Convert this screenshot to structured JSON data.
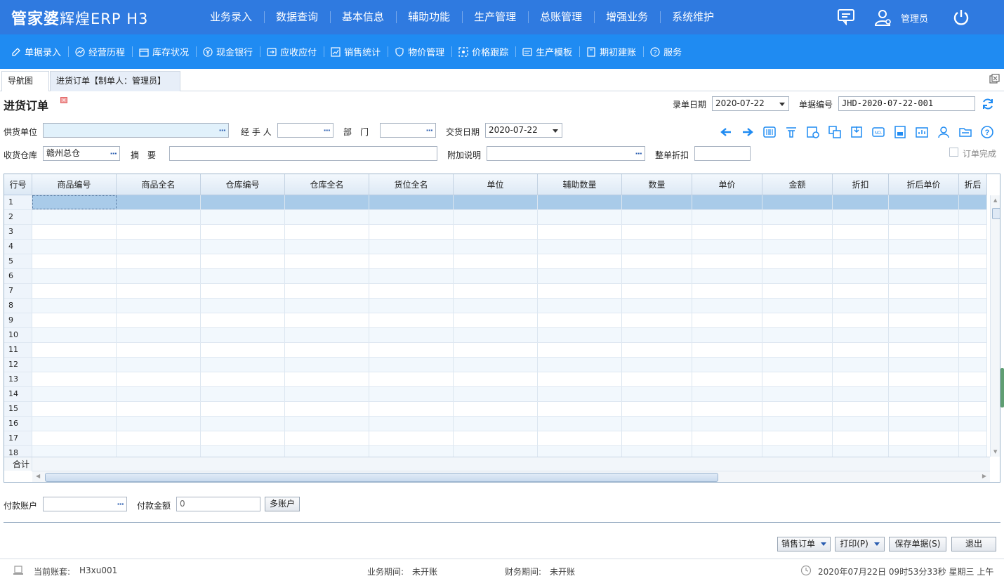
{
  "app": {
    "logo_main": "管家婆",
    "logo_sub": "辉煌ERP H3",
    "menu": [
      "业务录入",
      "数据查询",
      "基本信息",
      "辅助功能",
      "生产管理",
      "总账管理",
      "增强业务",
      "系统维护"
    ],
    "user": "管理员"
  },
  "toolbar": [
    "单据录入",
    "经营历程",
    "库存状况",
    "现金银行",
    "应收应付",
    "销售统计",
    "物价管理",
    "价格跟踪",
    "生产模板",
    "期初建账",
    "服务"
  ],
  "tabs": {
    "nav": "导航图",
    "active": "进货订单【制单人：管理员】"
  },
  "form": {
    "title": "进货订单",
    "entry_date_label": "录单日期",
    "entry_date": "2020-07-22",
    "doc_no_label": "单据编号",
    "doc_no": "JHD-2020-07-22-001",
    "supplier_label": "供货单位",
    "supplier": "",
    "handler_label": "经 手 人",
    "handler": "",
    "dept_label": "部　门",
    "dept": "",
    "delivery_label": "交货日期",
    "delivery_date": "2020-07-22",
    "warehouse_label": "收货仓库",
    "warehouse": "赣州总仓",
    "summary_label": "摘　要",
    "summary": "",
    "note_label": "附加说明",
    "note": "",
    "discount_label": "整单折扣",
    "discount": "",
    "complete_label": "订单完成"
  },
  "grid": {
    "columns": [
      "行号",
      "商品编号",
      "商品全名",
      "仓库编号",
      "仓库全名",
      "货位全名",
      "单位",
      "辅助数量",
      "数量",
      "单价",
      "金额",
      "折扣",
      "折后单价",
      "折后"
    ],
    "rows": [
      "1",
      "2",
      "3",
      "4",
      "5",
      "6",
      "7",
      "8",
      "9",
      "10",
      "11",
      "12",
      "13",
      "14",
      "15",
      "16",
      "17",
      "18"
    ],
    "total_label": "合计"
  },
  "payment": {
    "account_label": "付款账户",
    "account": "",
    "amount_label": "付款金额",
    "amount": "0",
    "multi_button": "多账户"
  },
  "buttons": {
    "sales_order": "销售订单",
    "print": "打印(P)",
    "save": "保存单据(S)",
    "exit": "退出"
  },
  "status": {
    "account_label": "当前账套:",
    "account": "H3xu001",
    "biz_period": "业务期间:　未开账",
    "fin_period": "财务期间:　未开账",
    "datetime": "2020年07月22日 09时53分33秒 星期三 上午"
  },
  "icons": [
    "arrow-left-icon",
    "arrow-right-icon",
    "barcode-icon",
    "filter-icon",
    "settings-doc-icon",
    "copy-icon",
    "import-icon",
    "number-icon",
    "save-doc-icon",
    "report-icon",
    "user-icon",
    "folder-icon",
    "help-icon"
  ]
}
